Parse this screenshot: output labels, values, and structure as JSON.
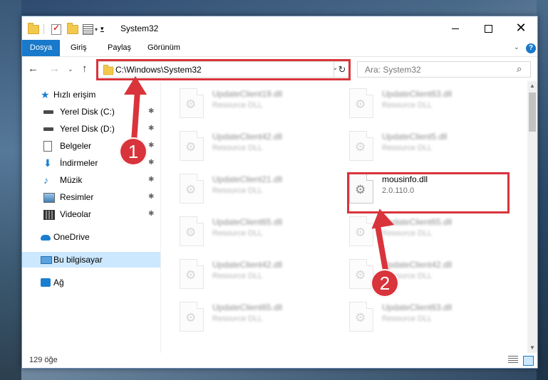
{
  "window": {
    "title": "System32",
    "minimize_icon": "minimize-icon",
    "maximize_icon": "maximize-icon",
    "close_icon": "close-icon",
    "close_glyph": "✕"
  },
  "ribbon": {
    "tabs": [
      "Dosya",
      "Giriş",
      "Paylaş",
      "Görünüm"
    ],
    "help_label": "?"
  },
  "navigation": {
    "back_glyph": "←",
    "forward_glyph": "→",
    "recent_glyph": "⌄",
    "up_glyph": "↑",
    "address_path": "C:\\Windows\\System32",
    "address_dropdown_glyph": "⌄",
    "refresh_glyph": "↻",
    "search_placeholder": "Ara: System32",
    "search_glyph": "⌕"
  },
  "sidebar": {
    "quick_access": "Hızlı erişim",
    "items": [
      {
        "label": "Yerel Disk (C:)",
        "pinned": true
      },
      {
        "label": "Yerel Disk (D:)",
        "pinned": true
      },
      {
        "label": "Belgeler",
        "pinned": true
      },
      {
        "label": "İndirmeler",
        "pinned": true
      },
      {
        "label": "Müzik",
        "pinned": true
      },
      {
        "label": "Resimler",
        "pinned": true
      },
      {
        "label": "Videolar",
        "pinned": true
      }
    ],
    "onedrive": "OneDrive",
    "this_pc": "Bu bilgisayar",
    "network": "Ağ",
    "pin_glyph": "📌"
  },
  "files": {
    "left_column": [
      {
        "name": "UpdateClient19.dll",
        "desc": "Resource DLL"
      },
      {
        "name": "UpdateClient42.dll",
        "desc": "Resource DLL"
      },
      {
        "name": "UpdateClient21.dll",
        "desc": "Resource DLL"
      },
      {
        "name": "UpdateClient65.dll",
        "desc": "Resource DLL"
      },
      {
        "name": "UpdateClient42.dll",
        "desc": "Resource DLL"
      },
      {
        "name": "UpdateClient65.dll",
        "desc": "Resource DLL"
      }
    ],
    "right_column": [
      {
        "name": "UpdateClient63.dll",
        "desc": "Resource DLL"
      },
      {
        "name": "UpdateClient5.dll",
        "desc": "Resource DLL"
      },
      {
        "name": "mousinfo.dll",
        "desc": "2.0.110.0",
        "highlighted": true
      },
      {
        "name": "UpdateClient65.dll",
        "desc": "Resource DLL"
      },
      {
        "name": "UpdateClient42.dll",
        "desc": "Resource DLL"
      },
      {
        "name": "UpdateClient63.dll",
        "desc": "Resource DLL"
      }
    ],
    "gear_glyph": "⚙"
  },
  "status": {
    "item_count": "129 öğe"
  },
  "annotations": {
    "step1": "1",
    "step2": "2",
    "color": "#d9343b"
  },
  "colors": {
    "accent": "#1979ca",
    "selection": "#cce8ff"
  }
}
